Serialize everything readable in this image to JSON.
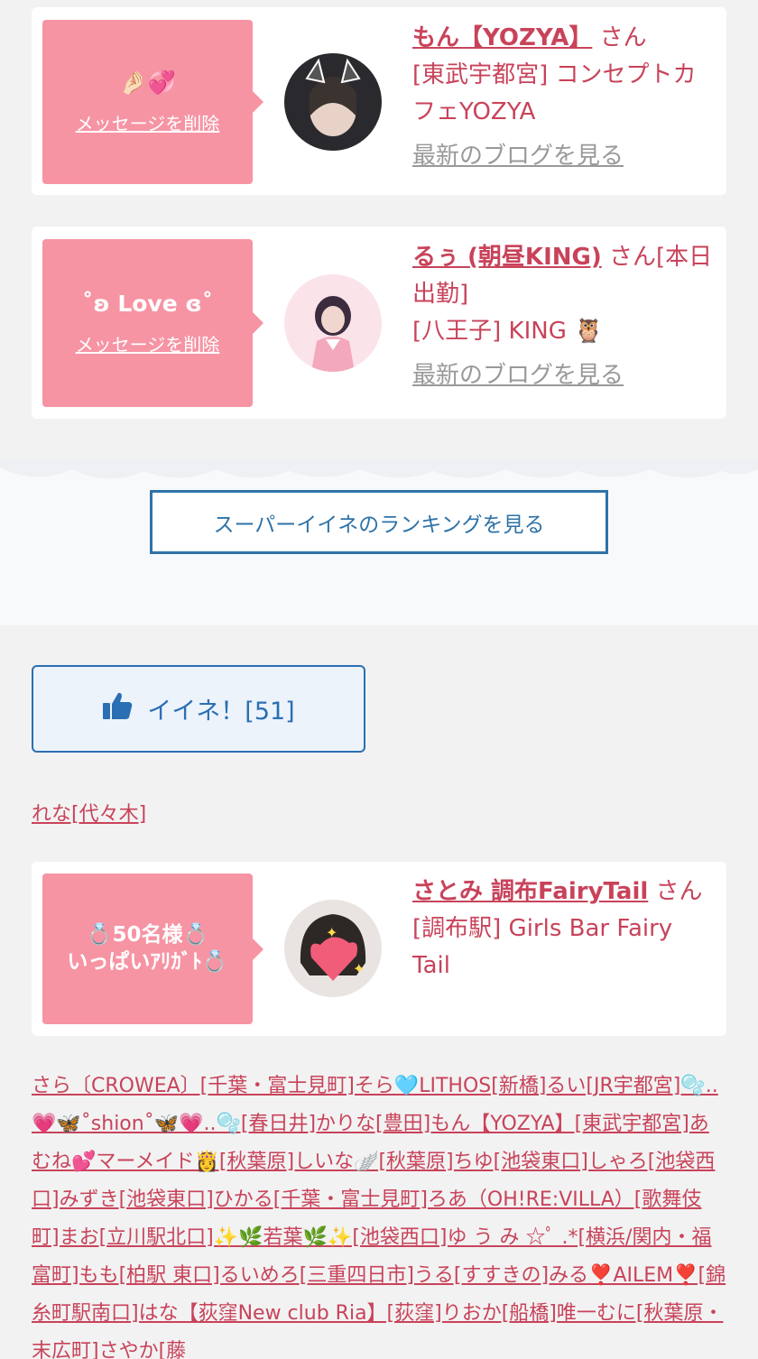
{
  "cards": [
    {
      "message_emoji": "🤌🏻💞",
      "delete_label": "メッセージを削除",
      "name": "もん【YOZYA】",
      "honorific": " さん",
      "location_line": "[東武宇都宮] コンセプトカフェYOZYA",
      "blog_label": "最新のブログを見る"
    },
    {
      "message_text": "˚ʚ Love ɞ˚",
      "delete_label": "メッセージを削除",
      "name": "るぅ (朝昼KING)",
      "honorific": " さん[本日出勤]",
      "location_line": "[八王子] KING 🦉",
      "blog_label": "最新のブログを見る"
    },
    {
      "message_text": "💍50名様💍\nいっぱいｱﾘｶﾞﾄ💍",
      "name": "さとみ 調布FairyTail",
      "honorific": " さん",
      "location_line": "[調布駅] Girls Bar Fairy Tail"
    }
  ],
  "ranking_button": "スーパーイイネのランキングを見る",
  "like_button": {
    "icon": "thumbs-up-icon",
    "label": "イイネ！[51]"
  },
  "user_link": "れな[代々木]",
  "names_list": "さら〔CROWEA〕[千葉・富士見町]そら🩵LITHOS[新橋]るい[JR宇都宮]🫧..💗🦋˚shion˚🦋💗..🫧[春日井]かりな[豊田]もん【YOZYA】[東武宇都宮]あむね💕マーメイド👸[秋葉原]しいな🪽[秋葉原]ちゆ[池袋東口]しゃろ[池袋西口]みずき[池袋東口]ひかる[千葉・富士見町]ろあ（OH!RE:VILLA）[歌舞伎町]まお[立川駅北口]✨🌿若葉🌿✨[池袋西口]ゆ う み ☆ﾟ .*[横浜/関内・福富町]もも[柏駅 東口]るいめろ[三重四日市]うる[すすきの]みる❣️AILEM❣️[錦糸町駅南口]はな【荻窪New club Ria】[荻窪]りおか[船橋]唯一むに[秋葉原・末広町]さやか[藤",
  "colors": {
    "accent_pink": "#c8435a",
    "bubble_pink": "#f694a4",
    "blue": "#2a6fb3"
  }
}
